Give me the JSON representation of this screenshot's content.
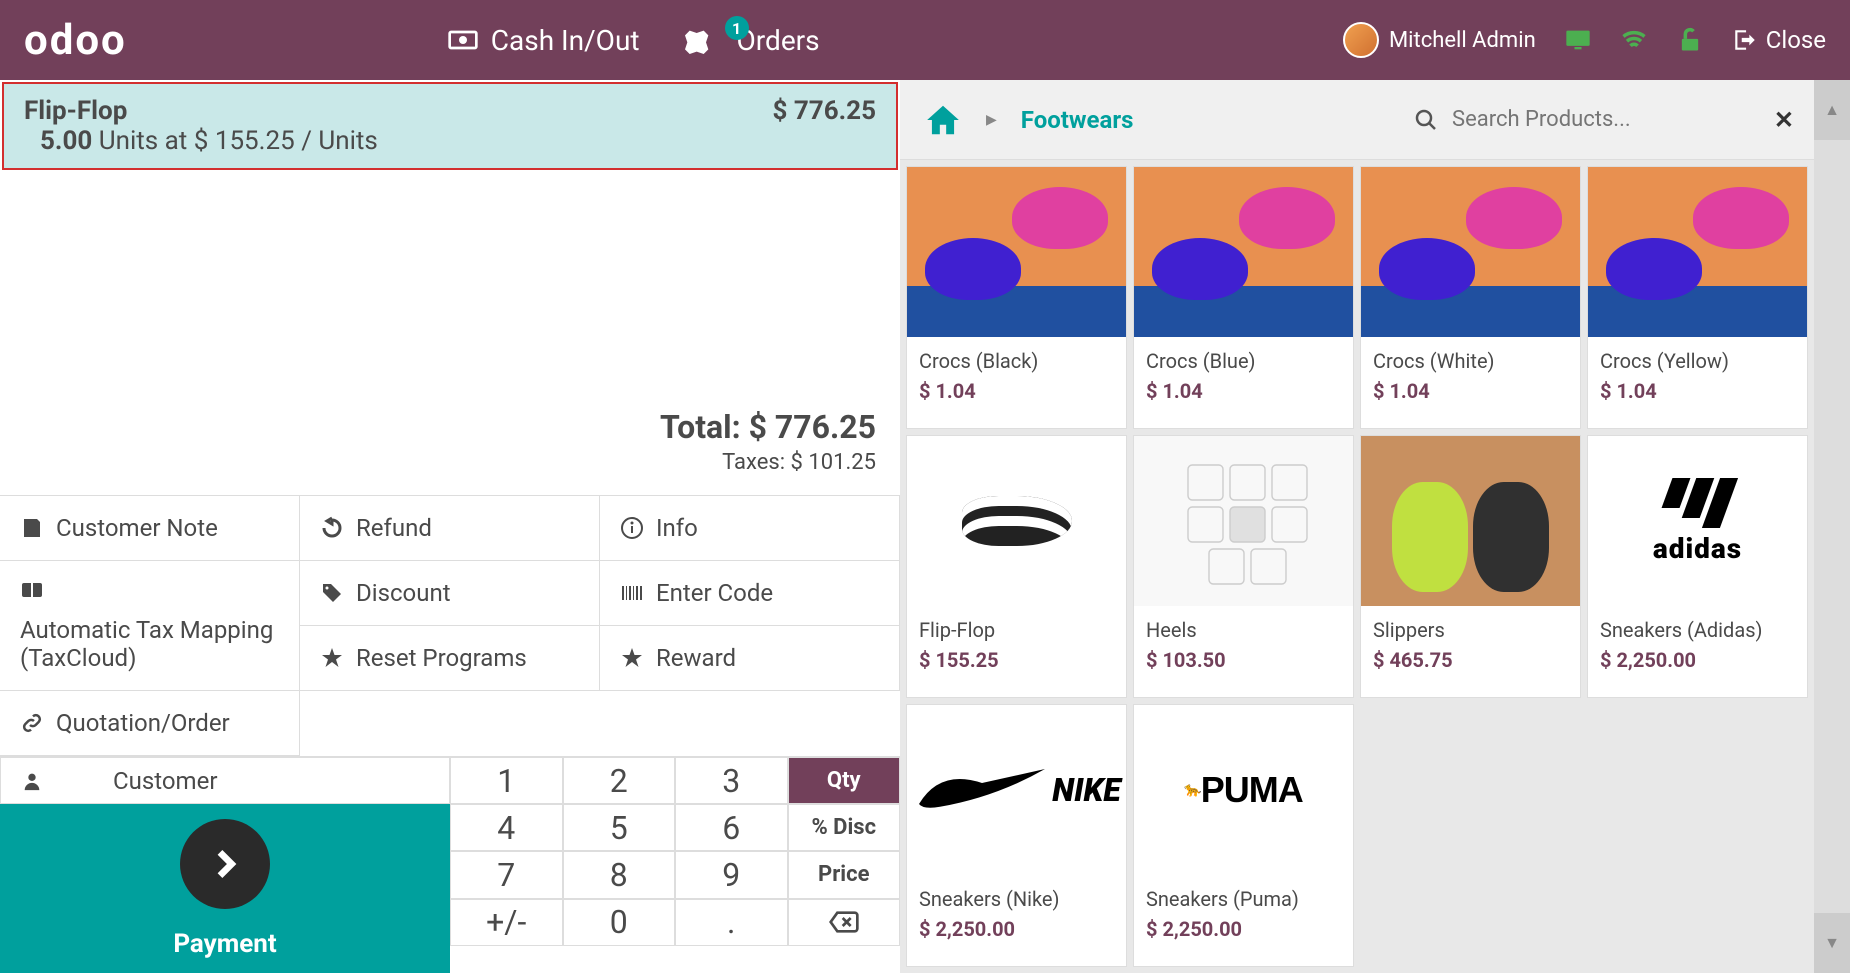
{
  "header": {
    "logo": "odoo",
    "cash_label": "Cash In/Out",
    "orders_label": "Orders",
    "orders_badge": "1",
    "user_name": "Mitchell Admin",
    "close_label": "Close"
  },
  "order": {
    "product_name": "Flip-Flop",
    "quantity": "5.00",
    "detail_unit_label": "Units at",
    "unit_price": "$ 155.25",
    "unit_suffix": "/ Units",
    "line_total": "$ 776.25",
    "total_label": "Total:",
    "total_value": "$ 776.25",
    "tax_label": "Taxes:",
    "tax_value": "$ 101.25"
  },
  "actions": {
    "customer_note": "Customer Note",
    "refund": "Refund",
    "info": "Info",
    "auto_tax": "Automatic Tax Mapping (TaxCloud)",
    "discount": "Discount",
    "enter_code": "Enter Code",
    "reset_programs": "Reset Programs",
    "reward": "Reward",
    "quotation": "Quotation/Order"
  },
  "keypad": {
    "customer_label": "Customer",
    "payment_label": "Payment",
    "keys": [
      "1",
      "2",
      "3",
      "4",
      "5",
      "6",
      "7",
      "8",
      "9",
      "+/-",
      "0",
      "."
    ],
    "qty_label": "Qty",
    "disc_label": "% Disc",
    "price_label": "Price"
  },
  "search": {
    "placeholder": "Search Products..."
  },
  "breadcrumb": {
    "category": "Footwears"
  },
  "products": [
    {
      "name": "Crocs (Black)",
      "price": "$ 1.04",
      "img": "crocs"
    },
    {
      "name": "Crocs (Blue)",
      "price": "$ 1.04",
      "img": "crocs"
    },
    {
      "name": "Crocs (White)",
      "price": "$ 1.04",
      "img": "crocs"
    },
    {
      "name": "Crocs (Yellow)",
      "price": "$ 1.04",
      "img": "crocs"
    },
    {
      "name": "Flip-Flop",
      "price": "$ 155.25",
      "img": "flipflop"
    },
    {
      "name": "Heels",
      "price": "$ 103.50",
      "img": "heels"
    },
    {
      "name": "Slippers",
      "price": "$ 465.75",
      "img": "slippers"
    },
    {
      "name": "Sneakers (Adidas)",
      "price": "$ 2,250.00",
      "img": "adidas"
    },
    {
      "name": "Sneakers (Nike)",
      "price": "$ 2,250.00",
      "img": "nike"
    },
    {
      "name": "Sneakers (Puma)",
      "price": "$ 2,250.00",
      "img": "puma"
    }
  ]
}
